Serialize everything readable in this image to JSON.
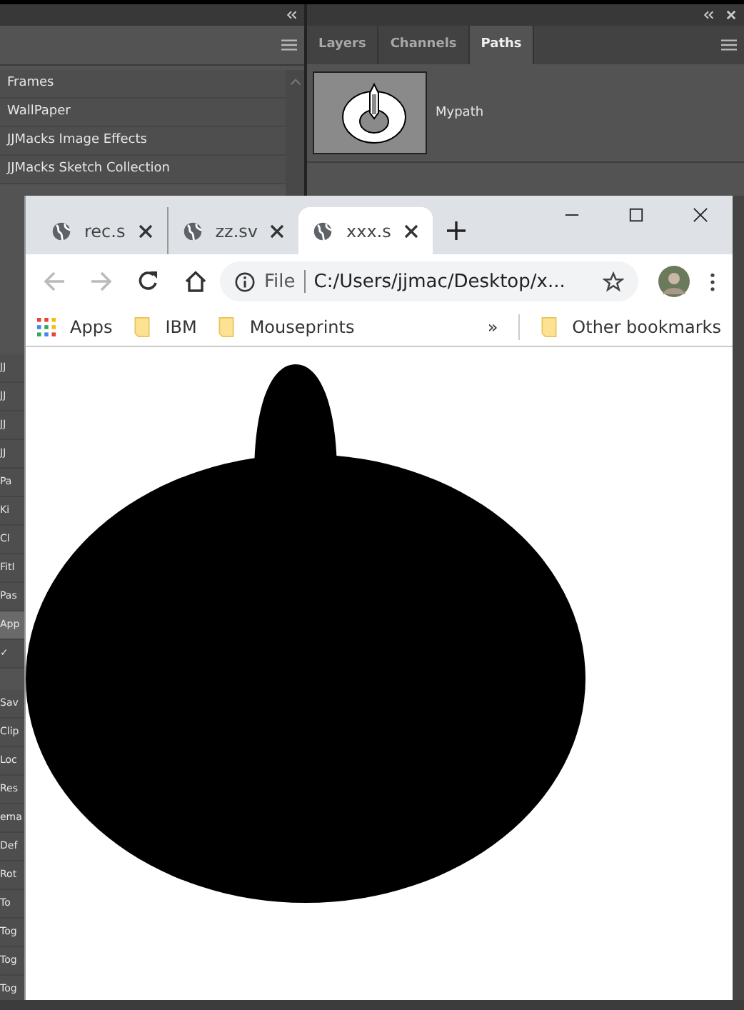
{
  "left_panel": {
    "items": [
      {
        "label": "Frames"
      },
      {
        "label": "WallPaper"
      },
      {
        "label": "JJMacks Image Effects"
      },
      {
        "label": "JJMacks Sketch Collection"
      }
    ],
    "edge_groups": [
      {
        "items": [
          {
            "label": "JJ",
            "selected": false
          },
          {
            "label": "JJ",
            "selected": false
          },
          {
            "label": "JJ",
            "selected": false
          },
          {
            "label": "JJ",
            "selected": false
          },
          {
            "label": "Pa",
            "selected": false
          },
          {
            "label": "Ki",
            "selected": false
          },
          {
            "label": "Cl",
            "selected": false
          },
          {
            "label": "FitI",
            "selected": false
          },
          {
            "label": "Pas",
            "selected": false
          },
          {
            "label": "App",
            "selected": true
          },
          {
            "label": "✓",
            "selected": false
          }
        ]
      },
      {
        "items": [
          {
            "label": "Sav",
            "selected": false
          },
          {
            "label": "Clip",
            "selected": false
          },
          {
            "label": "Loc",
            "selected": false
          },
          {
            "label": "Res",
            "selected": false
          },
          {
            "label": "ema",
            "selected": false
          },
          {
            "label": "Def",
            "selected": false
          },
          {
            "label": "Rot",
            "selected": false
          },
          {
            "label": "To",
            "selected": false
          },
          {
            "label": "Tog",
            "selected": false
          },
          {
            "label": "Tog",
            "selected": false
          },
          {
            "label": "Tog",
            "selected": false
          }
        ]
      }
    ]
  },
  "paths_panel": {
    "tabs": [
      {
        "label": "Layers",
        "selected": false
      },
      {
        "label": "Channels",
        "selected": false
      },
      {
        "label": "Paths",
        "selected": true
      }
    ],
    "paths": [
      {
        "name": "Mypath"
      }
    ]
  },
  "browser": {
    "tabs": [
      {
        "title": "rec.s",
        "selected": false
      },
      {
        "title": "zz.sv",
        "selected": false
      },
      {
        "title": "xxx.s",
        "selected": true
      }
    ],
    "address": {
      "scheme": "File",
      "url": "C:/Users/jjmac/Desktop/x..."
    },
    "bookmarks": [
      {
        "label": "Apps",
        "kind": "apps"
      },
      {
        "label": "IBM",
        "kind": "folder"
      },
      {
        "label": "Mouseprints",
        "kind": "folder"
      }
    ],
    "overflow": "»",
    "other_bookmarks": "Other bookmarks"
  }
}
